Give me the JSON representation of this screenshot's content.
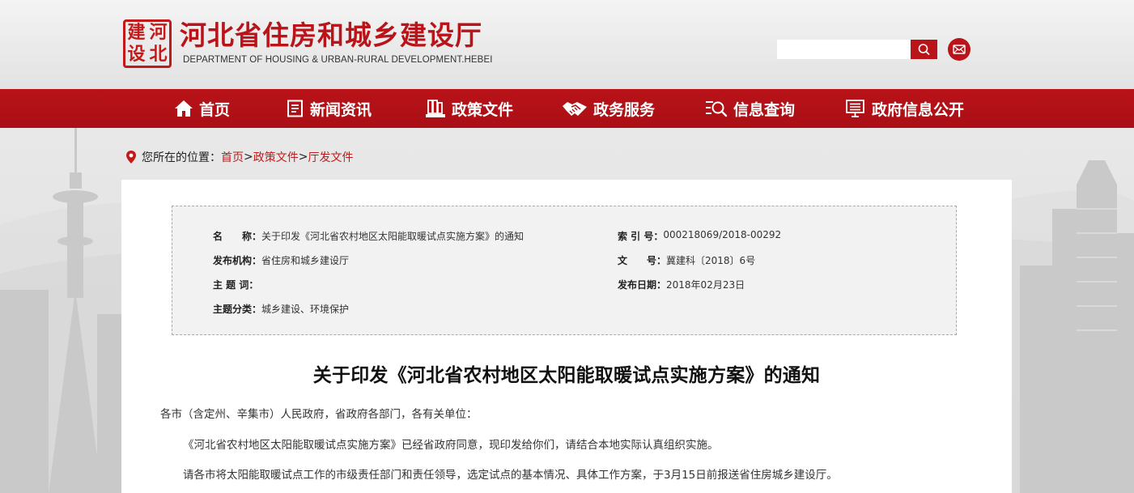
{
  "header": {
    "seal_chars": [
      "建",
      "河",
      "设",
      "北"
    ],
    "title": "河北省住房和城乡建设厅",
    "subtitle": "DEPARTMENT OF HOUSING & URBAN-RURAL DEVELOPMENT.HEBEI",
    "search": {
      "value": "",
      "placeholder": "",
      "icon": "search-icon"
    },
    "mail_icon": "mail-icon"
  },
  "nav": {
    "items": [
      {
        "label": "首页",
        "icon": "home-icon"
      },
      {
        "label": "新闻资讯",
        "icon": "news-icon"
      },
      {
        "label": "政策文件",
        "icon": "policy-icon"
      },
      {
        "label": "政务服务",
        "icon": "handshake-icon"
      },
      {
        "label": "信息查询",
        "icon": "search-list-icon"
      },
      {
        "label": "政府信息公开",
        "icon": "disclosure-icon"
      }
    ]
  },
  "breadcrumb": {
    "prefix": "您所在的位置：",
    "items": [
      "首页",
      "政策文件",
      "厅发文件"
    ],
    "separator": ">"
  },
  "meta": {
    "name_label": "名　　称：",
    "name_value": "关于印发《河北省农村地区太阳能取暖试点实施方案》的通知",
    "index_label": "索 引 号：",
    "index_value": "000218069/2018-00292",
    "issuer_label": "发布机构：",
    "issuer_value": "省住房和城乡建设厅",
    "docno_label": "文　　号：",
    "docno_value": "冀建科〔2018〕6号",
    "keywords_label": "主 题 词：",
    "keywords_value": "",
    "date_label": "发布日期：",
    "date_value": "2018年02月23日",
    "category_label": "主题分类：",
    "category_value": "城乡建设、环境保护"
  },
  "document": {
    "title": "关于印发《河北省农村地区太阳能取暖试点实施方案》的通知",
    "salutation": "各市（含定州、辛集市）人民政府，省政府各部门，各有关单位：",
    "paragraph_1": "《河北省农村地区太阳能取暖试点实施方案》已经省政府同意，现印发给你们，请结合本地实际认真组织实施。",
    "paragraph_2": "请各市将太阳能取暖试点工作的市级责任部门和责任领导，选定试点的基本情况、具体工作方案，于3月15日前报送省住房城乡建设厅。"
  },
  "colors": {
    "brand_red": "#b8141a",
    "link_red": "#c21a1a",
    "meta_bg": "#f2f2f2"
  }
}
